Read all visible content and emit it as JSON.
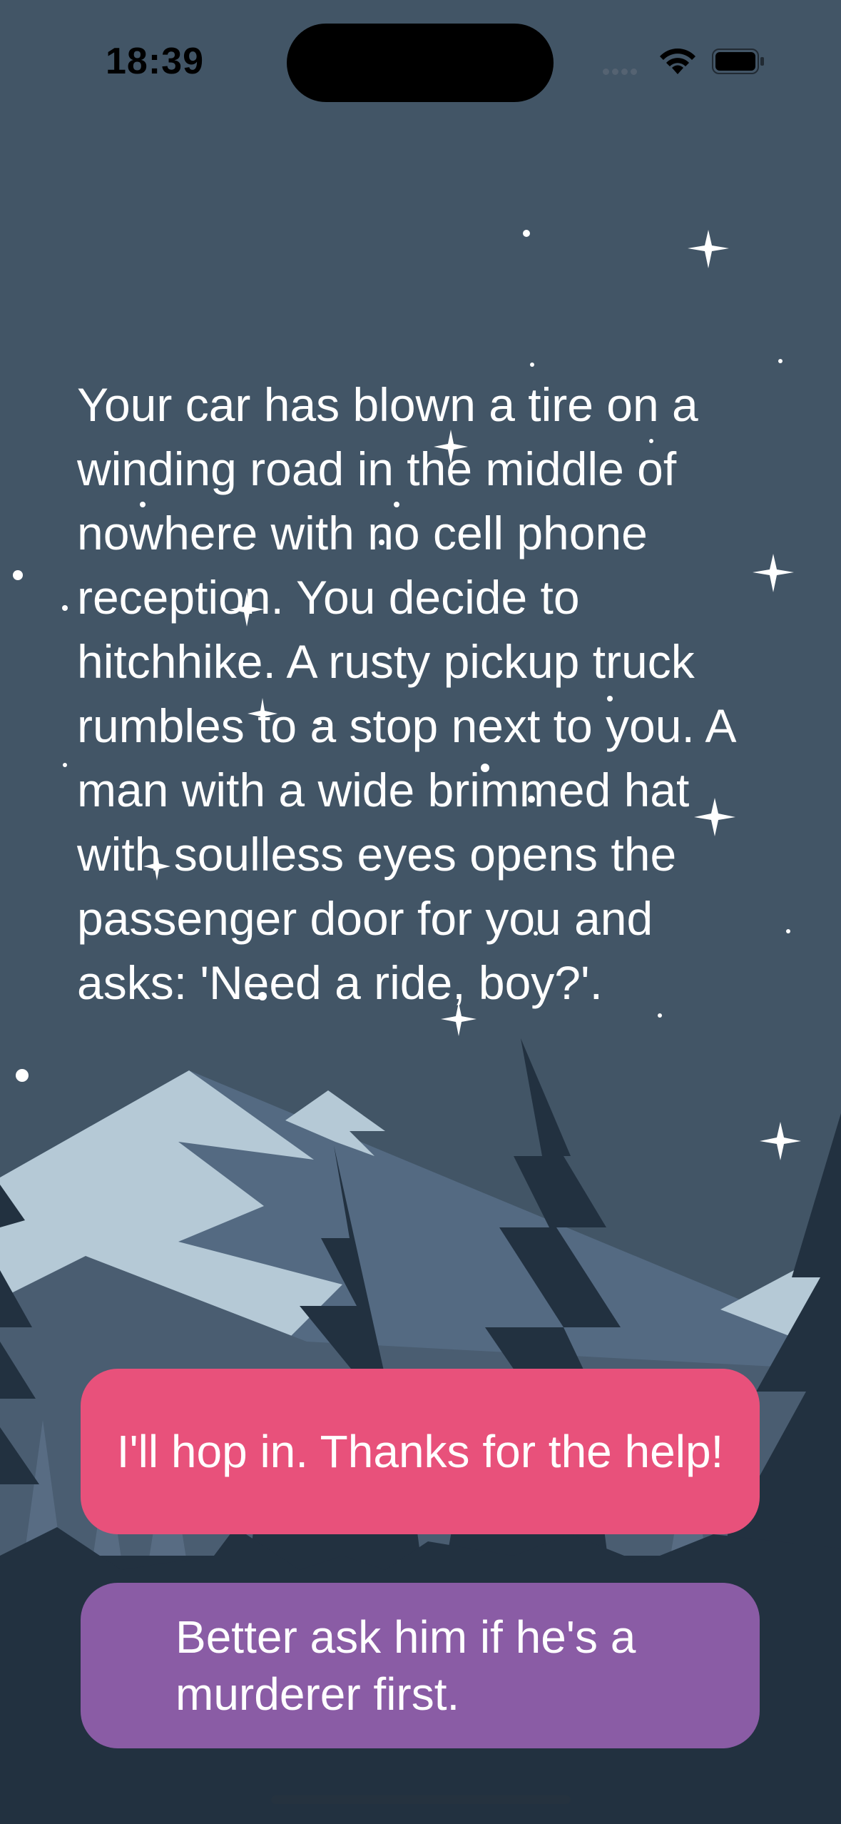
{
  "status_bar": {
    "time": "18:39"
  },
  "story": {
    "text": "Your car has blown a tire on a winding road in the middle of nowhere with no cell phone reception. You decide to hitchhike. A rusty pickup truck rumbles to a stop next to you. A man with a wide brimmed hat with soulless eyes opens the passenger door for you and asks: 'Need a ride, boy?'."
  },
  "choices": [
    {
      "label": "I'll hop in. Thanks for the help!",
      "color": "#e8517b"
    },
    {
      "label": "Better ask him if he's a murderer first.",
      "color": "#8a5ca5"
    }
  ],
  "colors": {
    "sky": "#425566",
    "mountain_snow": "#b5c9d6",
    "mountain_shadow": "#546a82",
    "trees": "#223140"
  }
}
